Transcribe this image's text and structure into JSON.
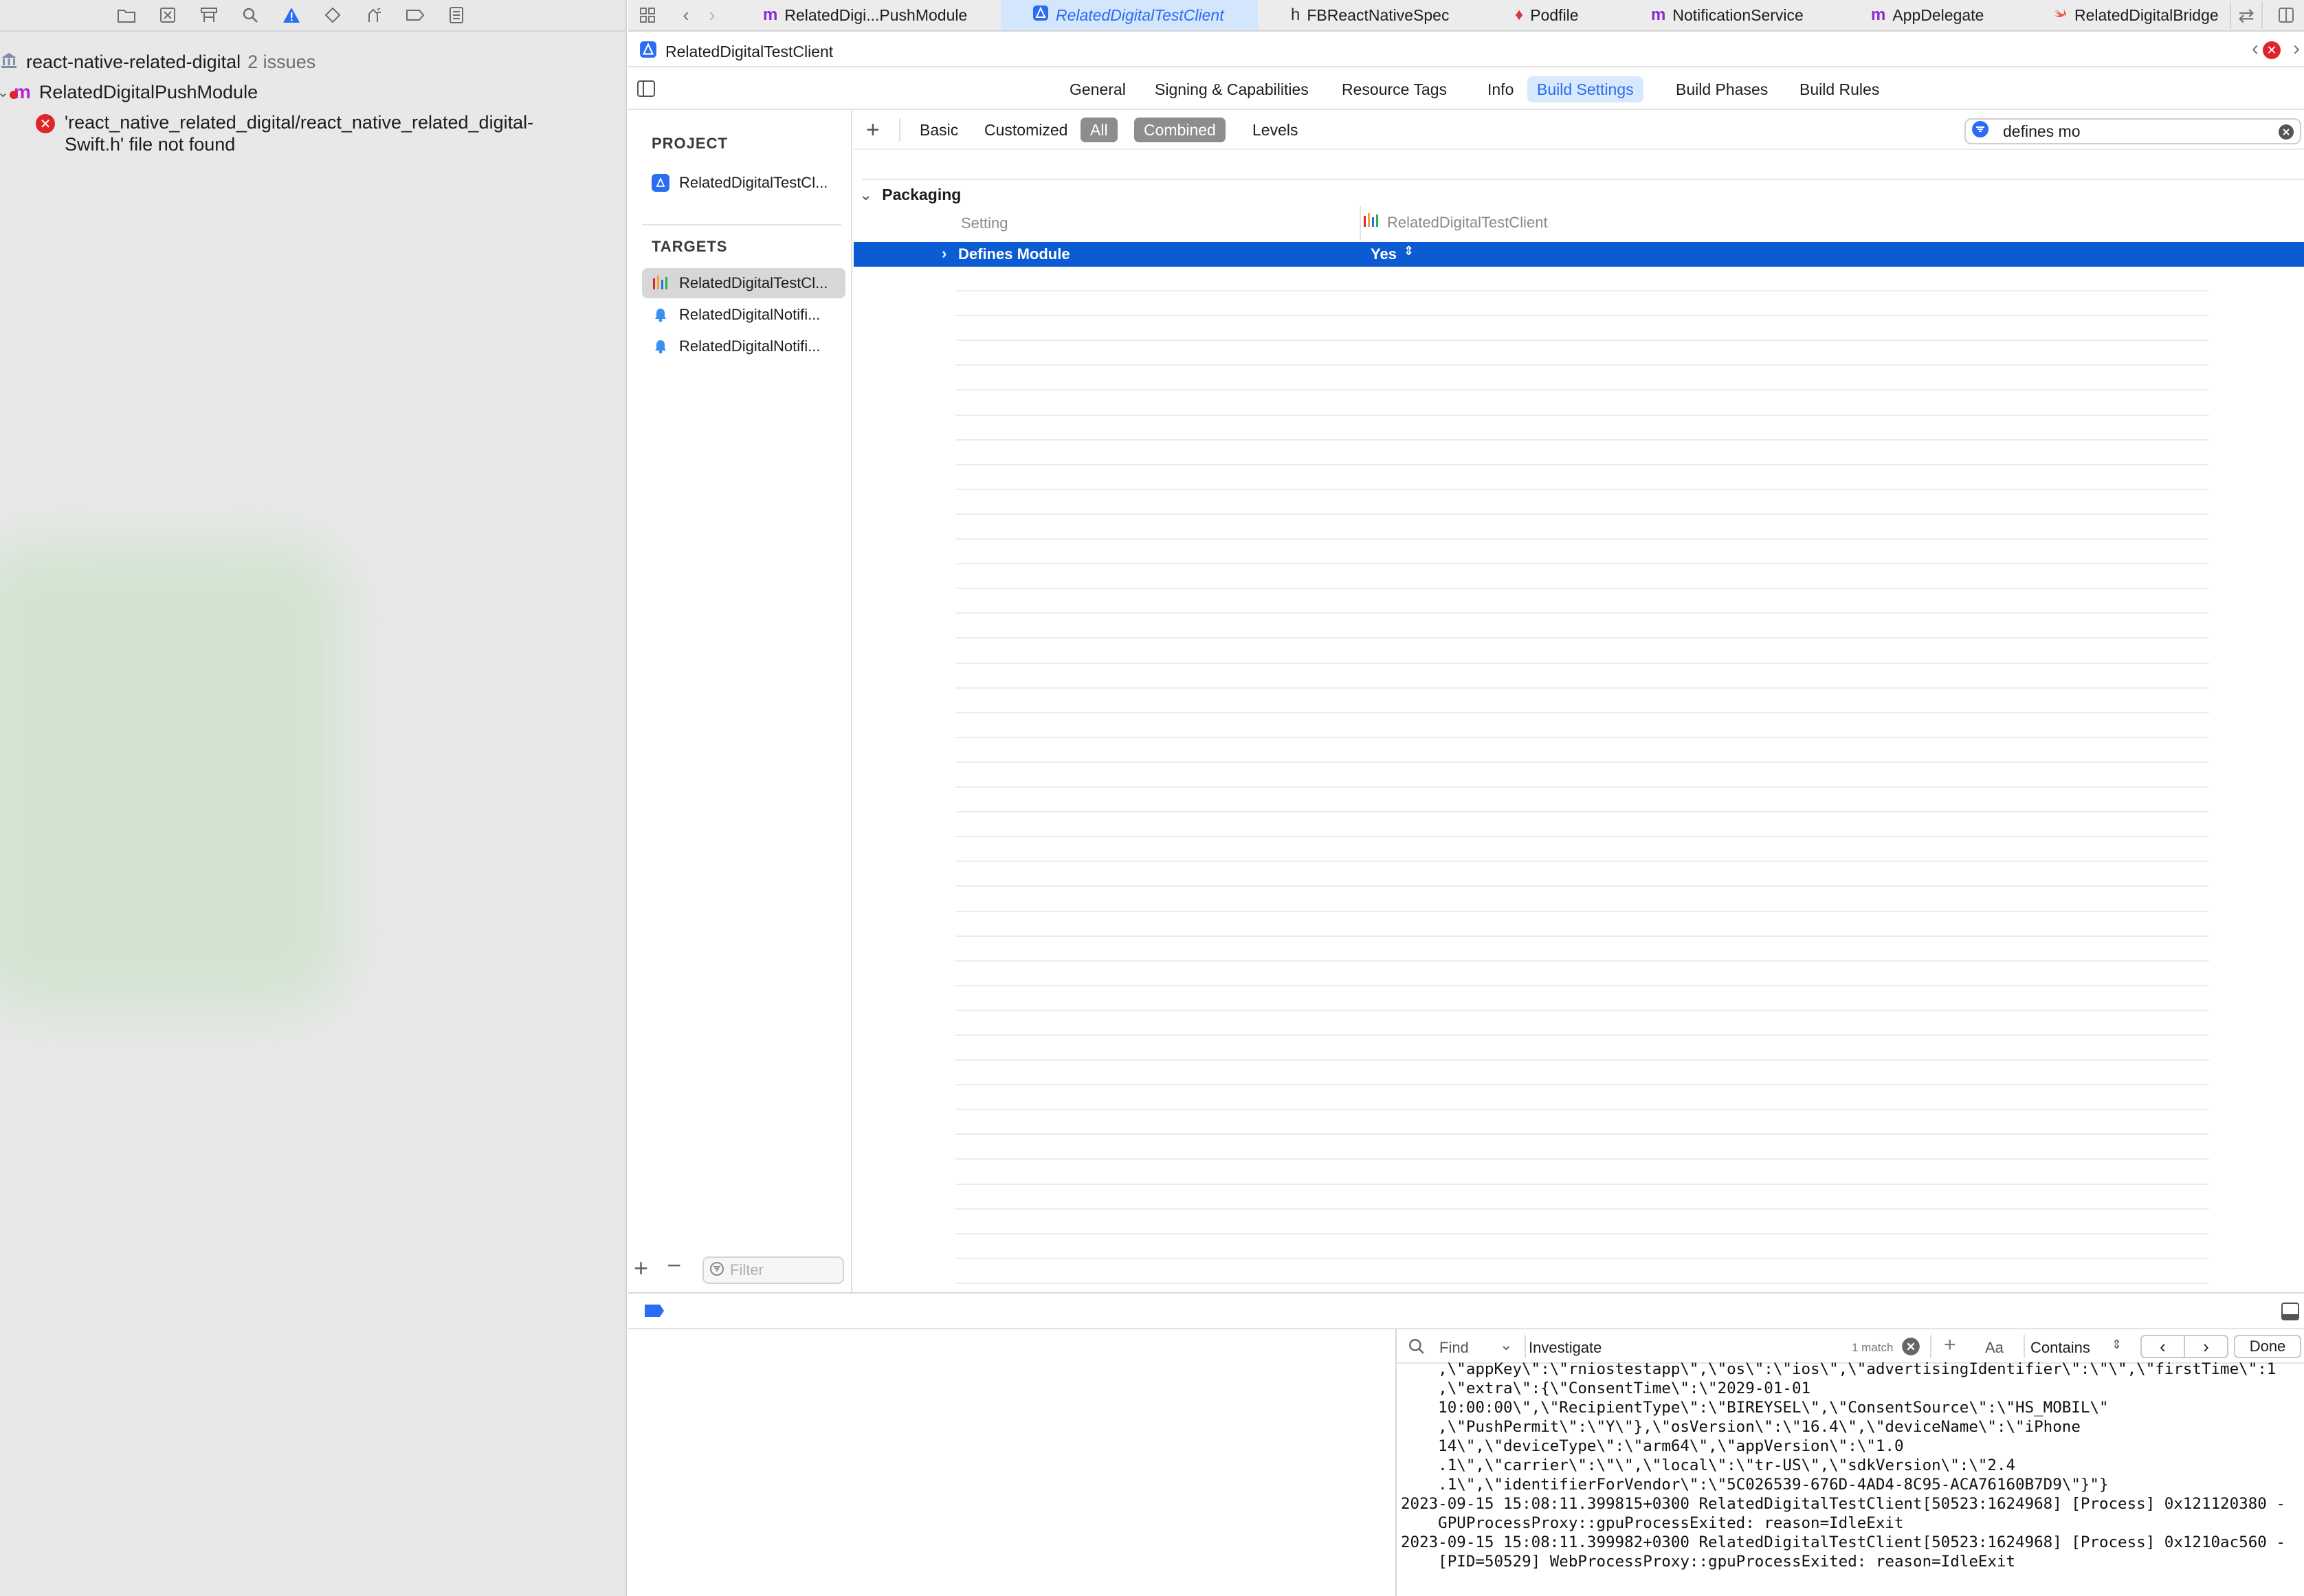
{
  "navigator": {
    "toolbar_icons": [
      "folder-icon",
      "source-control-icon",
      "hierarchy-icon",
      "search-icon",
      "warning-icon",
      "test-icon",
      "debug-icon",
      "breakpoint-icon",
      "report-icon"
    ],
    "project": {
      "name": "react-native-related-digital",
      "issues": "2 issues"
    },
    "module": {
      "name": "RelatedDigitalPushModule"
    },
    "error": {
      "line1": "'react_native_related_digital/react_native_related_digital-",
      "line2": "Swift.h' file not found"
    }
  },
  "tabs": [
    {
      "label": "RelatedDigi...PushModule",
      "icon": "m",
      "active": false
    },
    {
      "label": "RelatedDigitalTestClient",
      "icon": "A",
      "active": true
    },
    {
      "label": "FBReactNativeSpec",
      "icon": "h",
      "active": false
    },
    {
      "label": "Podfile",
      "icon": "◆",
      "active": false
    },
    {
      "label": "NotificationService",
      "icon": "m",
      "active": false
    },
    {
      "label": "AppDelegate",
      "icon": "m",
      "active": false
    },
    {
      "label": "RelatedDigitalBridge",
      "icon": "swift",
      "active": false
    }
  ],
  "jumpbar": {
    "title": "RelatedDigitalTestClient"
  },
  "editor_tabs": [
    "General",
    "Signing & Capabilities",
    "Resource Tags",
    "Info",
    "Build Settings",
    "Build Phases",
    "Build Rules"
  ],
  "editor_tab_active": "Build Settings",
  "targets_panel": {
    "project_header": "PROJECT",
    "project_item": "RelatedDigitalTestCl...",
    "targets_header": "TARGETS",
    "targets": [
      "RelatedDigitalTestCl...",
      "RelatedDigitalNotifi...",
      "RelatedDigitalNotifi..."
    ],
    "filter_placeholder": "Filter"
  },
  "settings": {
    "add_label": "+",
    "filters": [
      "Basic",
      "Customized",
      "All"
    ],
    "filter_active": "All",
    "modes": [
      "Combined",
      "Levels"
    ],
    "mode_active": "Combined",
    "search_value": "defines mo",
    "group_title": "Packaging",
    "column_setting": "Setting",
    "column_target": "RelatedDigitalTestClient",
    "row_name": "Defines Module",
    "row_value": "Yes"
  },
  "console": {
    "find_label": "Find",
    "find_query": "Investigate",
    "match_count": "1 match",
    "case_label": "Aa",
    "mode_label": "Contains",
    "done_label": "Done",
    "log_lines": [
      "    ,\\\"appKey\\\":\\\"rniostestapp\\\",\\\"os\\\":\\\"ios\\\",\\\"advertisingIdentifier\\\":\\\"\\\",\\\"firstTime\\\":1",
      "    ,\\\"extra\\\":{\\\"ConsentTime\\\":\\\"2029-01-01",
      "    10:00:00\\\",\\\"RecipientType\\\":\\\"BIREYSEL\\\",\\\"ConsentSource\\\":\\\"HS_MOBIL\\\"",
      "    ,\\\"PushPermit\\\":\\\"Y\\\"},\\\"osVersion\\\":\\\"16.4\\\",\\\"deviceName\\\":\\\"iPhone",
      "    14\\\",\\\"deviceType\\\":\\\"arm64\\\",\\\"appVersion\\\":\\\"1.0",
      "    .1\\\",\\\"carrier\\\":\\\"\\\",\\\"local\\\":\\\"tr-US\\\",\\\"sdkVersion\\\":\\\"2.4",
      "    .1\\\",\\\"identifierForVendor\\\":\\\"5C026539-676D-4AD4-8C95-ACA76160B7D9\\\"}\"}",
      "2023-09-15 15:08:11.399815+0300 RelatedDigitalTestClient[50523:1624968] [Process] 0x121120380 -",
      "    GPUProcessProxy::gpuProcessExited: reason=IdleExit",
      "2023-09-15 15:08:11.399982+0300 RelatedDigitalTestClient[50523:1624968] [Process] 0x1210ac560 -",
      "    [PID=50529] WebProcessProxy::gpuProcessExited: reason=IdleExit"
    ]
  },
  "colors": {
    "accent": "#2a6cf2",
    "selection": "#0b5bd3",
    "error": "#e0242b"
  }
}
